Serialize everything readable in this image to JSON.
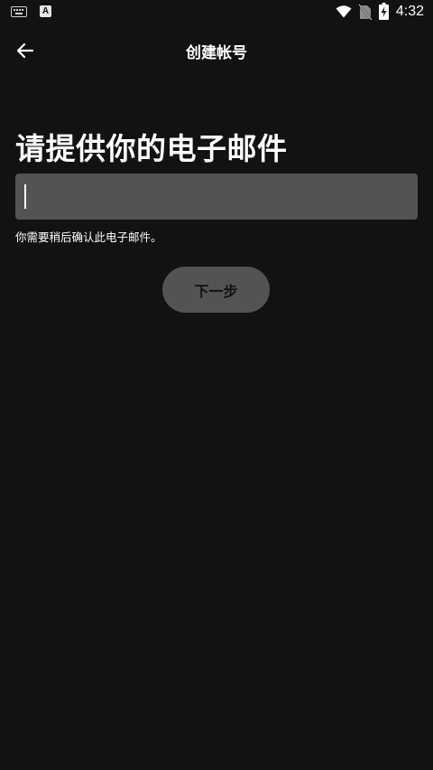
{
  "status_bar": {
    "time": "4:32",
    "icons": [
      "keyboard-icon",
      "text-a-icon",
      "wifi-icon",
      "no-sim-icon",
      "battery-charging-icon"
    ]
  },
  "app_bar": {
    "back_icon": "arrow-left-icon",
    "title": "创建帐号"
  },
  "main": {
    "heading": "请提供你的电子邮件",
    "email_value": "",
    "hint": "你需要稍后确认此电子邮件。",
    "next_label": "下一步"
  }
}
